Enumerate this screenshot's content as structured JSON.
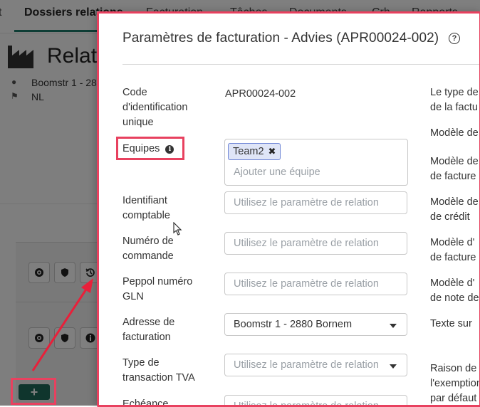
{
  "background": {
    "tabs": [
      "t",
      "Dossiers relations",
      "Facturation",
      "Tâches",
      "Documents",
      "Crh",
      "Rapports"
    ],
    "relation_title": "Relat",
    "address": "Boomstr 1 - 28",
    "country": "NL",
    "add_button": "+"
  },
  "modal": {
    "title": "Paramètres de facturation - Advies (APR00024-002)",
    "left_fields": [
      {
        "label": "Code d'identification unique",
        "value": "APR00024-002"
      },
      {
        "label": "Equipes",
        "tag": "Team2",
        "placeholder": "Ajouter une équipe"
      },
      {
        "label": "Identifiant comptable",
        "placeholder": "Utilisez le paramètre de relation"
      },
      {
        "label": "Numéro de commande",
        "placeholder": "Utilisez le paramètre de relation"
      },
      {
        "label": "Peppol numéro GLN",
        "placeholder": "Utilisez le paramètre de relation"
      },
      {
        "label": "Adresse de facturation",
        "value": "Boomstr 1 - 2880 Bornem"
      },
      {
        "label": "Type de transaction TVA",
        "placeholder": "Utilisez le paramètre de relation"
      },
      {
        "label": "Echéance",
        "placeholder": "Utilisez le paramètre de relation"
      }
    ],
    "right_labels": [
      "Le type de",
      "de la factu",
      "Modèle de",
      "Modèle de",
      "de facture",
      "Modèle de",
      "de crédit",
      "Modèle d'",
      "de facture",
      "Modèle d'",
      "de note de",
      "Texte sur",
      "Raison de",
      "l'exemption",
      "par défaut"
    ]
  },
  "colors": {
    "highlight": "#e8415f",
    "accent": "#1f6b5a",
    "tag_bg": "#dfe5f7",
    "tag_border": "#6f86d6"
  }
}
